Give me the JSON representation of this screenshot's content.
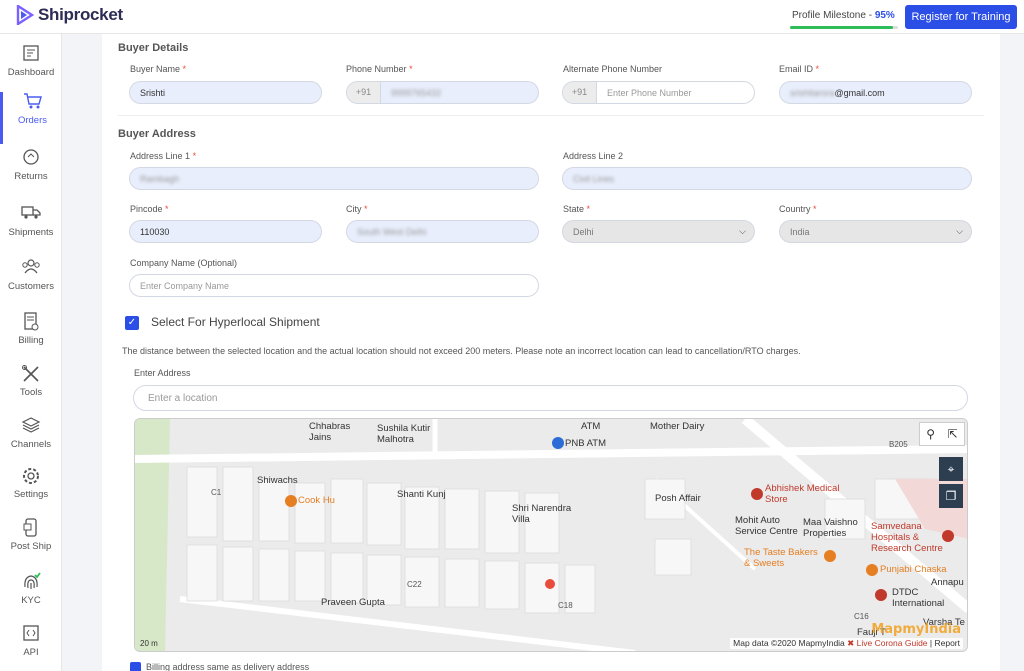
{
  "header": {
    "brand": "Shiprocket",
    "milestone_label": "Profile Milestone - ",
    "milestone_value": "95%",
    "milestone_fraction": 0.95,
    "register_button": "Register for Training"
  },
  "sidebar": {
    "items": [
      {
        "label": "Dashboard",
        "icon": "dashboard-icon"
      },
      {
        "label": "Orders",
        "icon": "cart-icon"
      },
      {
        "label": "Returns",
        "icon": "returns-icon"
      },
      {
        "label": "Shipments",
        "icon": "truck-icon"
      },
      {
        "label": "Customers",
        "icon": "customers-icon"
      },
      {
        "label": "Billing",
        "icon": "billing-icon"
      },
      {
        "label": "Tools",
        "icon": "tools-icon"
      },
      {
        "label": "Channels",
        "icon": "layers-icon"
      },
      {
        "label": "Settings",
        "icon": "gear-icon"
      },
      {
        "label": "Post Ship",
        "icon": "post-ship-icon"
      },
      {
        "label": "KYC",
        "icon": "fingerprint-icon"
      },
      {
        "label": "API",
        "icon": "api-icon"
      }
    ],
    "active": "Orders"
  },
  "buyer_details": {
    "title": "Buyer Details",
    "name_label": "Buyer Name",
    "name_value": "Srishti",
    "phone_label": "Phone Number",
    "phone_prefix": "+91",
    "phone_value": "9999765432",
    "alt_phone_label": "Alternate Phone Number",
    "alt_phone_prefix": "+91",
    "alt_phone_placeholder": "Enter Phone Number",
    "email_label": "Email ID",
    "email_blurred": "srishtiarora",
    "email_domain": "@gmail.com"
  },
  "buyer_address": {
    "title": "Buyer Address",
    "line1_label": "Address Line 1",
    "line1_value": "Rambagh",
    "line2_label": "Address Line 2",
    "line2_value": "Civil Lines",
    "pincode_label": "Pincode",
    "pincode_value": "110030",
    "city_label": "City",
    "city_value": "South West Delhi",
    "state_label": "State",
    "state_value": "Delhi",
    "country_label": "Country",
    "country_value": "India",
    "company_label": "Company Name (Optional)",
    "company_placeholder": "Enter Company Name"
  },
  "hyperlocal": {
    "label": "Select For Hyperlocal Shipment",
    "checked": true,
    "note": "The distance between the selected location and the actual location should not exceed 200 meters. Please note an incorrect location can lead to cancellation/RTO charges.",
    "address_label": "Enter Address",
    "address_placeholder": "Enter a location"
  },
  "map": {
    "labels": {
      "chhabras": "Chhabras\nJains",
      "sushila": "Sushila Kutir\nMalhotra",
      "atm": "ATM",
      "pnb_atm": "PNB ATM",
      "mother_dairy": "Mother Dairy",
      "b205": "B205",
      "c1": "C1",
      "shiwachs": "Shiwachs",
      "cook_hu": "Cook Hu",
      "shanti_kunj": "Shanti Kunj",
      "shri_narendra": "Shri Narendra\nVilla",
      "posh_affair": "Posh Affair",
      "abhishek": "Abhishek Medical\nStore",
      "mohit_auto": "Mohit Auto\nService Centre",
      "maa_vaishno": "Maa Vaishno\nProperties",
      "samvedana": "Samvedana\nHospitals &\nResearch Centre",
      "taste_bakers": "The Taste Bakers\n& Sweets",
      "punjabi_chaska": "Punjabi Chaska",
      "annapu": "Annapu",
      "c22": "C22",
      "praveen": "Praveen Gupta",
      "c18": "C18",
      "dtdc": "DTDC\nInternational",
      "c16": "C16",
      "fauji": "Fauji T",
      "varsha": "Varsha Te"
    },
    "scale": "20 m",
    "watermark": "MapmyIndia",
    "credit": "Map data ©2020 MapmyIndia",
    "corona_link": "Live Corona Guide",
    "report": "Report"
  },
  "billing": {
    "label": "Billing address same as delivery address"
  },
  "colors": {
    "primary": "#2b4ee6",
    "milestone_green": "#2ebd59",
    "required": "#e74c3c"
  }
}
